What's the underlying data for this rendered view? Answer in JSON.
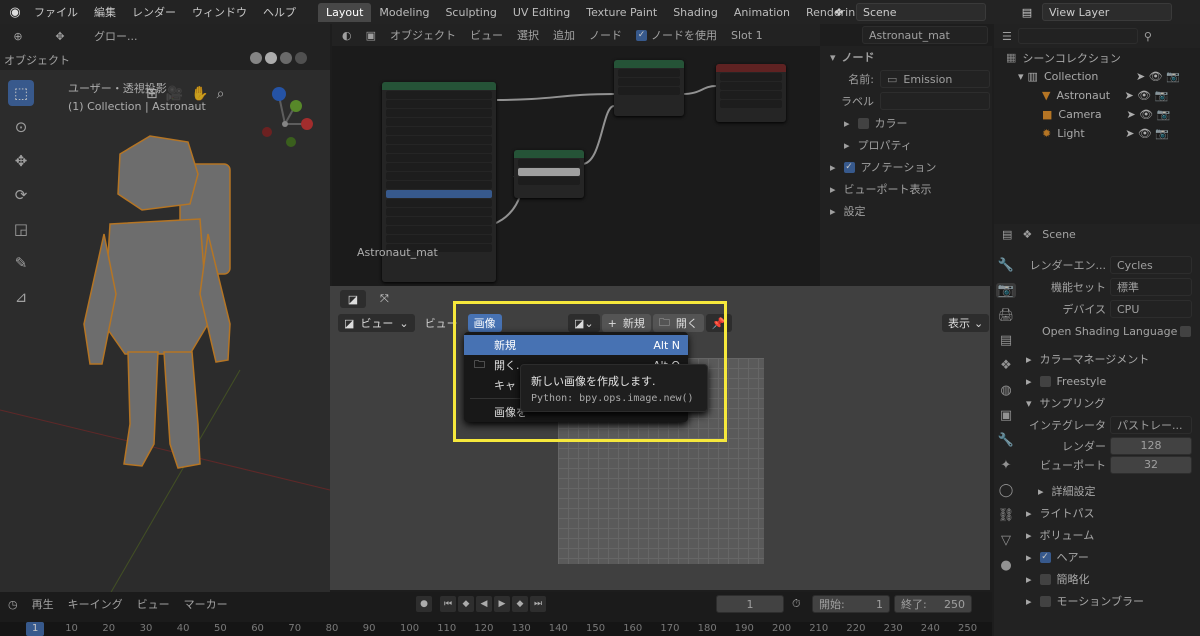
{
  "topbar": {
    "menus": [
      "ファイル",
      "編集",
      "レンダー",
      "ウィンドウ",
      "ヘルプ"
    ],
    "workspaces": [
      "Layout",
      "Modeling",
      "Sculpting",
      "UV Editing",
      "Texture Paint",
      "Shading",
      "Animation",
      "Renderin"
    ],
    "scene": "Scene",
    "view_layer": "View Layer"
  },
  "viewport": {
    "mode": "オブジェクト",
    "transform": "グロー...",
    "view_label": "ユーザー・透視投影",
    "collection_label": "(1) Collection | Astronaut"
  },
  "node_editor": {
    "mode": "オブジェクト",
    "menus": [
      "ビュー",
      "選択",
      "追加",
      "ノード"
    ],
    "use_nodes": "ノードを使用",
    "slot": "Slot 1",
    "material": "Astronaut_mat",
    "node_label": "Astronaut_mat"
  },
  "node_props": {
    "tab": "ノード",
    "name_label": "名前:",
    "name_value": "Emission",
    "label_label": "ラベル",
    "sections": [
      "カラー",
      "プロパティ",
      "アノテーション",
      "ビューポート表示",
      "設定"
    ]
  },
  "outliner": {
    "title": "シーンコレクション",
    "items": [
      {
        "label": "Collection",
        "icon": "collection-icon"
      },
      {
        "label": "Astronaut",
        "icon": "mesh-icon"
      },
      {
        "label": "Camera",
        "icon": "camera-icon"
      },
      {
        "label": "Light",
        "icon": "light-icon"
      }
    ]
  },
  "props": {
    "scene": "Scene",
    "render_engine_label": "レンダーエン...",
    "render_engine": "Cycles",
    "feature_set_label": "機能セット",
    "feature_set": "標準",
    "device_label": "デバイス",
    "device": "CPU",
    "osl": "Open Shading Language",
    "color_management": "カラーマネージメント",
    "freestyle": "Freestyle",
    "sampling": "サンプリング",
    "integrator_label": "インテグレータ",
    "integrator": "パストレー...",
    "render_label": "レンダー",
    "render_samples": "128",
    "viewport_label": "ビューポート",
    "viewport_samples": "32",
    "advanced": "詳細設定",
    "light_paths": "ライトパス",
    "volume": "ボリューム",
    "hair": "ヘアー",
    "simplify": "簡略化",
    "motion_blur": "モーションブラー"
  },
  "image_editor": {
    "view_menu": "ビュー",
    "view_menu2": "ビュー",
    "image_menu": "画像",
    "new_button": "新規",
    "open_button": "開く",
    "display": "表示"
  },
  "dropdown": {
    "items": [
      {
        "label": "新規",
        "shortcut": "Alt N"
      },
      {
        "label": "開く...",
        "shortcut": "Alt O"
      },
      {
        "label": "キャ",
        "shortcut": ""
      },
      {
        "label": "画像を",
        "shortcut": ""
      }
    ],
    "tooltip_title": "新しい画像を作成します.",
    "tooltip_python": "Python: bpy.ops.image.new()"
  },
  "timeline": {
    "playback": "再生",
    "keying": "キーイング",
    "view": "ビュー",
    "marker": "マーカー",
    "current_frame": "1",
    "start_label": "開始:",
    "start": "1",
    "end_label": "終了:",
    "end": "250",
    "ticks": [
      "1",
      "10",
      "20",
      "30",
      "40",
      "50",
      "60",
      "70",
      "80",
      "90",
      "100",
      "110",
      "120",
      "130",
      "140",
      "150",
      "160",
      "170",
      "180",
      "190",
      "200",
      "210",
      "220",
      "230",
      "240",
      "250"
    ]
  },
  "colors": {
    "accent": "#4772b3",
    "highlight_box": "#f6e83c",
    "selection_outline": "#e8962e"
  }
}
